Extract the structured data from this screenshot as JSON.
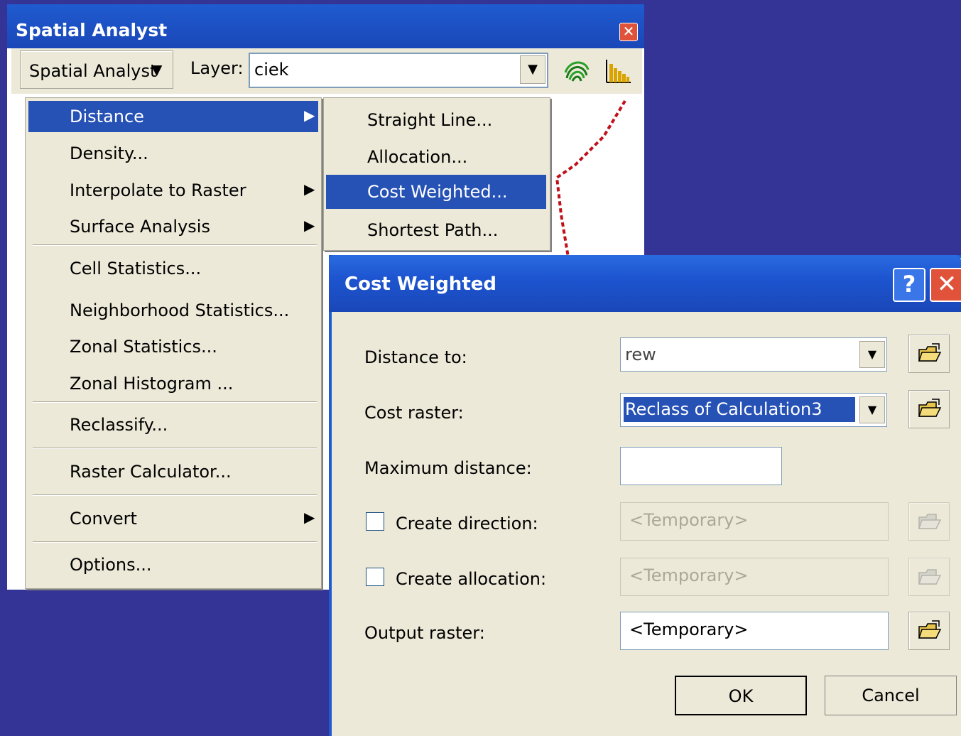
{
  "toolbar": {
    "title": "Spatial Analyst",
    "dropdown_label": "Spatial Analyst",
    "layer_label": "Layer:",
    "layer_value": "ciek",
    "icons": [
      "contour-tool-icon",
      "histogram-tool-icon"
    ]
  },
  "main_menu": {
    "items": [
      {
        "label": "Distance",
        "has_submenu": true,
        "highlighted": true
      },
      {
        "label": "Density...",
        "has_submenu": false
      },
      {
        "label": "Interpolate to Raster",
        "has_submenu": true
      },
      {
        "label": "Surface Analysis",
        "has_submenu": true
      },
      {
        "label": "Cell Statistics...",
        "has_submenu": false
      },
      {
        "label": "Neighborhood Statistics...",
        "has_submenu": false
      },
      {
        "label": "Zonal Statistics...",
        "has_submenu": false
      },
      {
        "label": "Zonal Histogram ...",
        "has_submenu": false
      },
      {
        "label": "Reclassify...",
        "has_submenu": false
      },
      {
        "label": "Raster Calculator...",
        "has_submenu": false
      },
      {
        "label": "Convert",
        "has_submenu": true
      },
      {
        "label": "Options...",
        "has_submenu": false
      }
    ]
  },
  "distance_submenu": {
    "items": [
      {
        "label": "Straight Line..."
      },
      {
        "label": "Allocation..."
      },
      {
        "label": "Cost Weighted...",
        "highlighted": true
      },
      {
        "label": "Shortest Path..."
      }
    ]
  },
  "dialog": {
    "title": "Cost Weighted",
    "help_glyph": "?",
    "close_glyph": "✕",
    "distance_to_label": "Distance to:",
    "distance_to_value": "rew",
    "cost_raster_label": "Cost raster:",
    "cost_raster_value": "Reclass of Calculation3",
    "max_distance_label": "Maximum distance:",
    "max_distance_value": "",
    "create_direction_label": "Create direction:",
    "create_direction_value": "<Temporary>",
    "create_allocation_label": "Create allocation:",
    "create_allocation_value": "<Temporary>",
    "output_raster_label": "Output raster:",
    "output_raster_value": "<Temporary>",
    "ok_label": "OK",
    "cancel_label": "Cancel"
  },
  "colors": {
    "desktop": "#343396",
    "title_blue": "#1f5bd0",
    "highlight": "#2651b5",
    "face": "#ece9d8",
    "close_red": "#e0533a"
  }
}
